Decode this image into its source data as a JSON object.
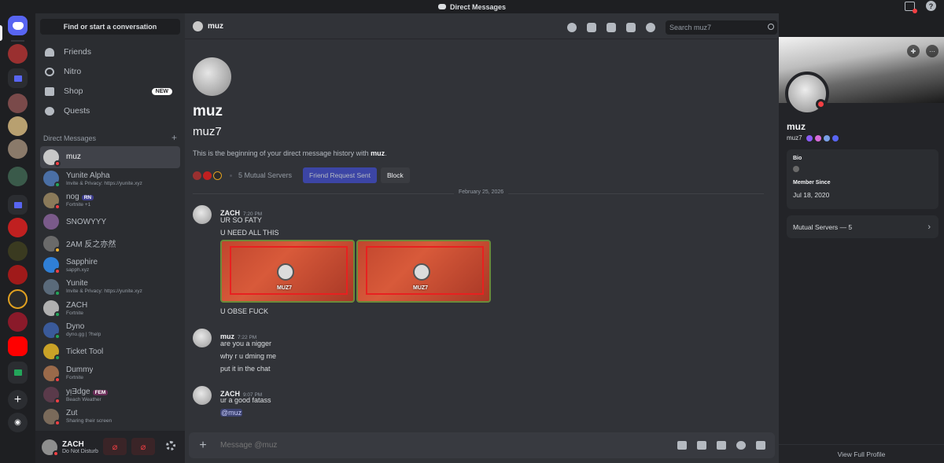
{
  "window": {
    "title": "Direct Messages"
  },
  "sidebar": {
    "search_label": "Find or start a conversation",
    "nav": [
      {
        "label": "Friends",
        "icon": "friends-icon"
      },
      {
        "label": "Nitro",
        "icon": "nitro-icon"
      },
      {
        "label": "Shop",
        "icon": "shop-icon",
        "badge": "NEW"
      },
      {
        "label": "Quests",
        "icon": "quests-icon"
      }
    ],
    "dm_header": "Direct Messages",
    "dm_add": "+",
    "dms": [
      {
        "name": "muz",
        "sub": "",
        "status": "dnd",
        "color": "#c8c8c8",
        "active": true
      },
      {
        "name": "Yunite Alpha",
        "sub": "Invite & Privacy: https://yunite.xyz",
        "status": "online",
        "color": "#4a6fa5"
      },
      {
        "name": "nog",
        "tag": "RN",
        "sub": "Fortnite +1",
        "status": "dnd",
        "color": "#8a7a5a"
      },
      {
        "name": "SNOWYYY",
        "sub": "",
        "status": "",
        "color": "#7a5a8a"
      },
      {
        "name": "2AM 反之亦然",
        "sub": "",
        "status": "idle",
        "color": "#6a6a6a"
      },
      {
        "name": "Sapphire",
        "sub": "sapph.xyz",
        "status": "dnd",
        "color": "#2f7fd6"
      },
      {
        "name": "Yunite",
        "sub": "Invite & Privacy: https://yunite.xyz",
        "status": "online",
        "color": "#5a6a7a"
      },
      {
        "name": "ZACH",
        "sub": "Fortnite",
        "status": "online",
        "color": "#b0b0b0"
      },
      {
        "name": "Dyno",
        "sub": "dyno.gg | ?help",
        "status": "online",
        "color": "#3a5a9a"
      },
      {
        "name": "Ticket Tool",
        "sub": "",
        "status": "online",
        "color": "#c9a227"
      },
      {
        "name": "Dummy",
        "sub": "Fortnite",
        "status": "dnd",
        "color": "#9a6a4a"
      },
      {
        "name": "yᴉƎdge",
        "tag": "FEM",
        "sub": "Beach Weather",
        "status": "dnd",
        "color": "#5a3a4a"
      },
      {
        "name": "Zut",
        "sub": "Sharing their screen",
        "status": "dnd",
        "color": "#7a6a5a"
      }
    ]
  },
  "userbar": {
    "name": "ZACH",
    "status": "Do Not Disturb"
  },
  "topbar": {
    "name": "muz",
    "search_placeholder": "Search muz7"
  },
  "intro": {
    "display_name": "muz",
    "username": "muz7",
    "desc_prefix": "This is the beginning of your direct message history with ",
    "desc_name": "muz",
    "desc_suffix": ".",
    "mutual_servers": "5 Mutual Servers",
    "friend_request_label": "Friend Request Sent",
    "block_label": "Block"
  },
  "date_divider": "February 25, 2026",
  "messages": [
    {
      "author": "ZACH",
      "time": "7:20 PM",
      "lines": [
        "UR SO FATY",
        "U NEED ALL THIS"
      ],
      "image_caption": "MUZ7",
      "after_lines": [
        "U OBSE FUCK"
      ]
    },
    {
      "author": "muz",
      "time": "7:22 PM",
      "lines": [
        "are you a nigger",
        "why r u dming me",
        "put it in the chat"
      ]
    },
    {
      "author": "ZACH",
      "time": "9:07 PM",
      "lines": [
        "ur a good fatass"
      ],
      "mention": "@muz"
    }
  ],
  "composer": {
    "placeholder": "Message @muz"
  },
  "profile": {
    "display_name": "muz",
    "username": "muz7",
    "bio_label": "Bio",
    "member_since_label": "Member Since",
    "member_since": "Jul 18, 2020",
    "mutual_servers": "Mutual Servers — 5",
    "view_full": "View Full Profile"
  },
  "colors": {
    "accent": "#5865f2",
    "dnd": "#f23f43",
    "online": "#23a55a",
    "idle": "#f0b232"
  }
}
